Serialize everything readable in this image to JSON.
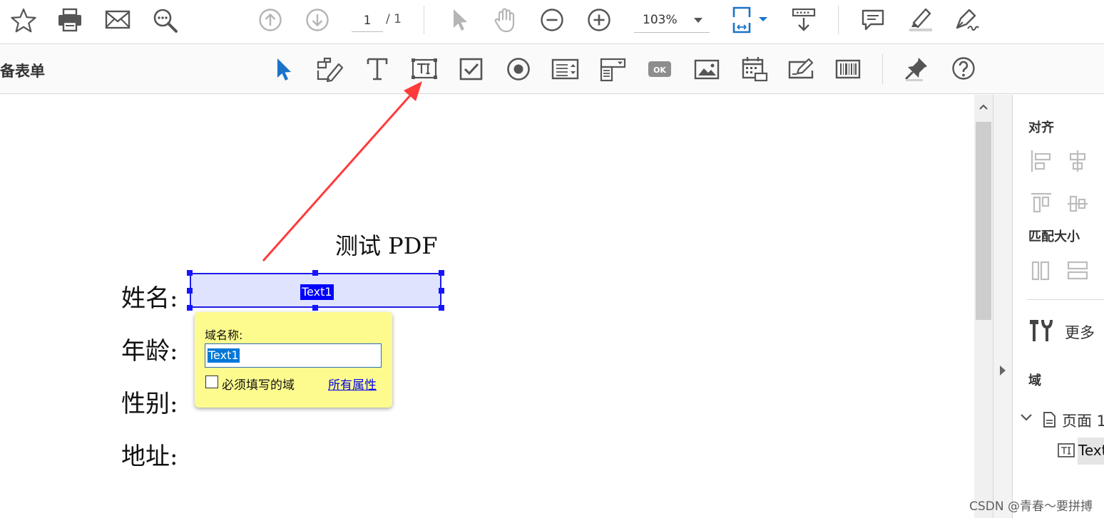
{
  "toolbar": {
    "page_current": "1",
    "page_total": "/ 1",
    "zoom": "103%"
  },
  "forms_toolbar": {
    "mode_label": "备表单"
  },
  "document": {
    "title": "测试 PDF",
    "labels": [
      "姓名:",
      "年龄:",
      "性别:",
      "地址:"
    ],
    "field_tag": "Text1"
  },
  "field_popup": {
    "title": "域名称:",
    "field_name": "Text1",
    "required_label": "必须填写的域",
    "required_checked": false,
    "all_properties_link": "所有属性"
  },
  "right_panel": {
    "align_heading": "对齐",
    "match_size_heading": "匹配大小",
    "more_label": "更多",
    "fields_heading": "域",
    "page_node": "页面 1",
    "field_node": "Text"
  },
  "watermark": "CSDN @青春～要拼搏",
  "colors": {
    "accent_blue": "#1a73c9",
    "field_border": "#1d1de8",
    "field_fill": "#dfe3fd",
    "popup_bg": "#fdfb8e",
    "arrow_red": "#ff3b3b"
  }
}
